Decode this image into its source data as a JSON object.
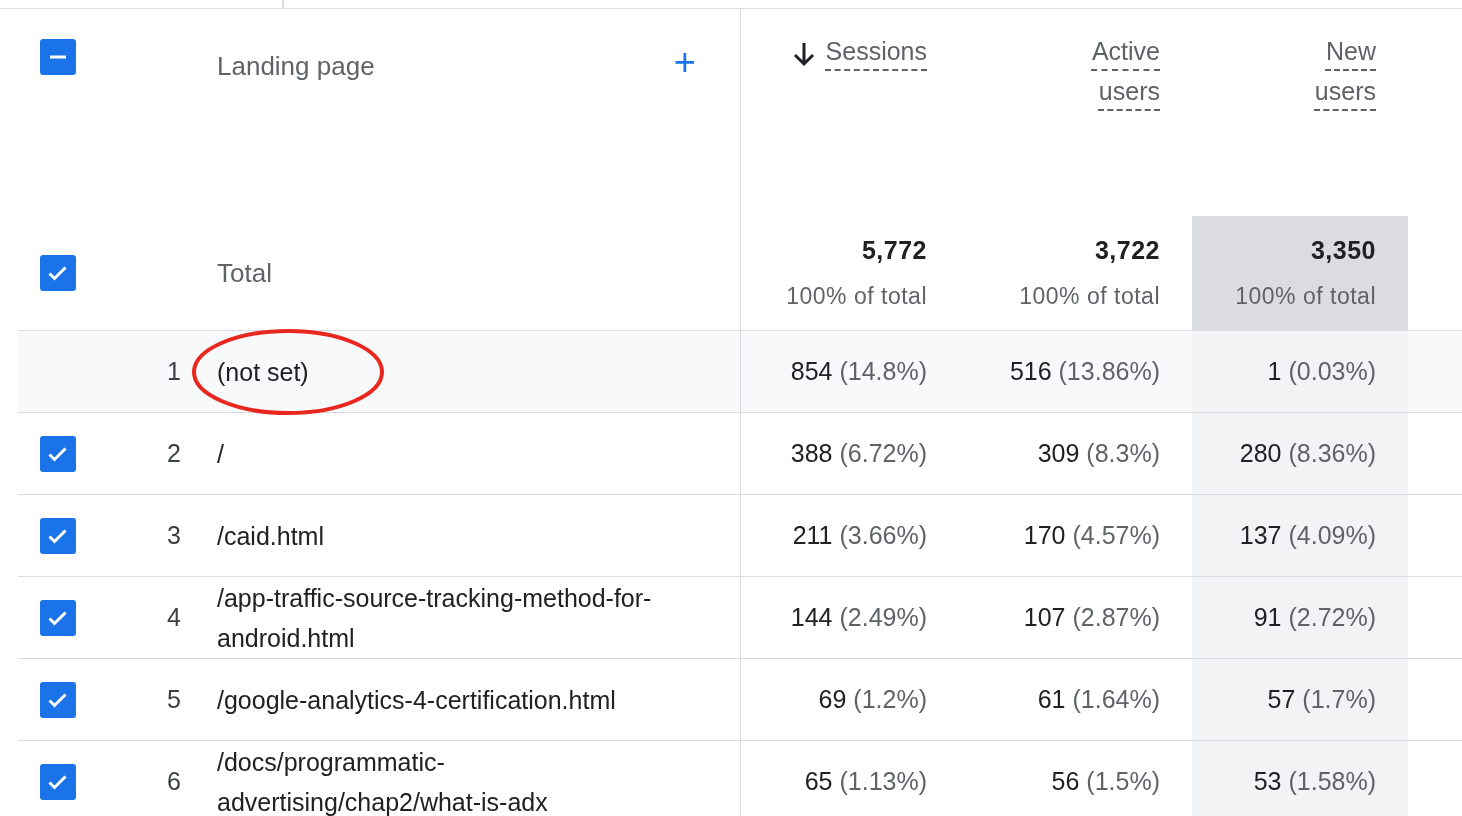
{
  "header": {
    "indeterminate": true,
    "dimension": "Landing page",
    "add_label": "+",
    "metrics": [
      {
        "label": "Sessions",
        "sorted": true,
        "highlighted": false
      },
      {
        "label": "Active users",
        "sorted": false,
        "highlighted": false
      },
      {
        "label": "New users",
        "sorted": false,
        "highlighted": true
      }
    ]
  },
  "total": {
    "checked": true,
    "label": "Total",
    "values": [
      {
        "value": "5,772",
        "share": "100% of total"
      },
      {
        "value": "3,722",
        "share": "100% of total"
      },
      {
        "value": "3,350",
        "share": "100% of total"
      }
    ]
  },
  "rows": [
    {
      "rank": "1",
      "page": "(not set)",
      "checked": false,
      "hovered": true,
      "circled": true,
      "values": [
        {
          "value": "854",
          "pct": "(14.8%)"
        },
        {
          "value": "516",
          "pct": "(13.86%)"
        },
        {
          "value": "1",
          "pct": "(0.03%)"
        }
      ]
    },
    {
      "rank": "2",
      "page": "/",
      "checked": true,
      "hovered": false,
      "circled": false,
      "values": [
        {
          "value": "388",
          "pct": "(6.72%)"
        },
        {
          "value": "309",
          "pct": "(8.3%)"
        },
        {
          "value": "280",
          "pct": "(8.36%)"
        }
      ]
    },
    {
      "rank": "3",
      "page": "/caid.html",
      "checked": true,
      "hovered": false,
      "circled": false,
      "values": [
        {
          "value": "211",
          "pct": "(3.66%)"
        },
        {
          "value": "170",
          "pct": "(4.57%)"
        },
        {
          "value": "137",
          "pct": "(4.09%)"
        }
      ]
    },
    {
      "rank": "4",
      "page": "/app-traffic-source-tracking-method-for-android.html",
      "checked": true,
      "hovered": false,
      "circled": false,
      "values": [
        {
          "value": "144",
          "pct": "(2.49%)"
        },
        {
          "value": "107",
          "pct": "(2.87%)"
        },
        {
          "value": "91",
          "pct": "(2.72%)"
        }
      ]
    },
    {
      "rank": "5",
      "page": "/google-analytics-4-certification.html",
      "checked": true,
      "hovered": false,
      "circled": false,
      "values": [
        {
          "value": "69",
          "pct": "(1.2%)"
        },
        {
          "value": "61",
          "pct": "(1.64%)"
        },
        {
          "value": "57",
          "pct": "(1.7%)"
        }
      ]
    },
    {
      "rank": "6",
      "page": "/docs/programmatic-advertising/chap2/what-is-adx",
      "checked": true,
      "hovered": false,
      "circled": false,
      "values": [
        {
          "value": "65",
          "pct": "(1.13%)"
        },
        {
          "value": "56",
          "pct": "(1.5%)"
        },
        {
          "value": "53",
          "pct": "(1.58%)"
        }
      ]
    }
  ]
}
